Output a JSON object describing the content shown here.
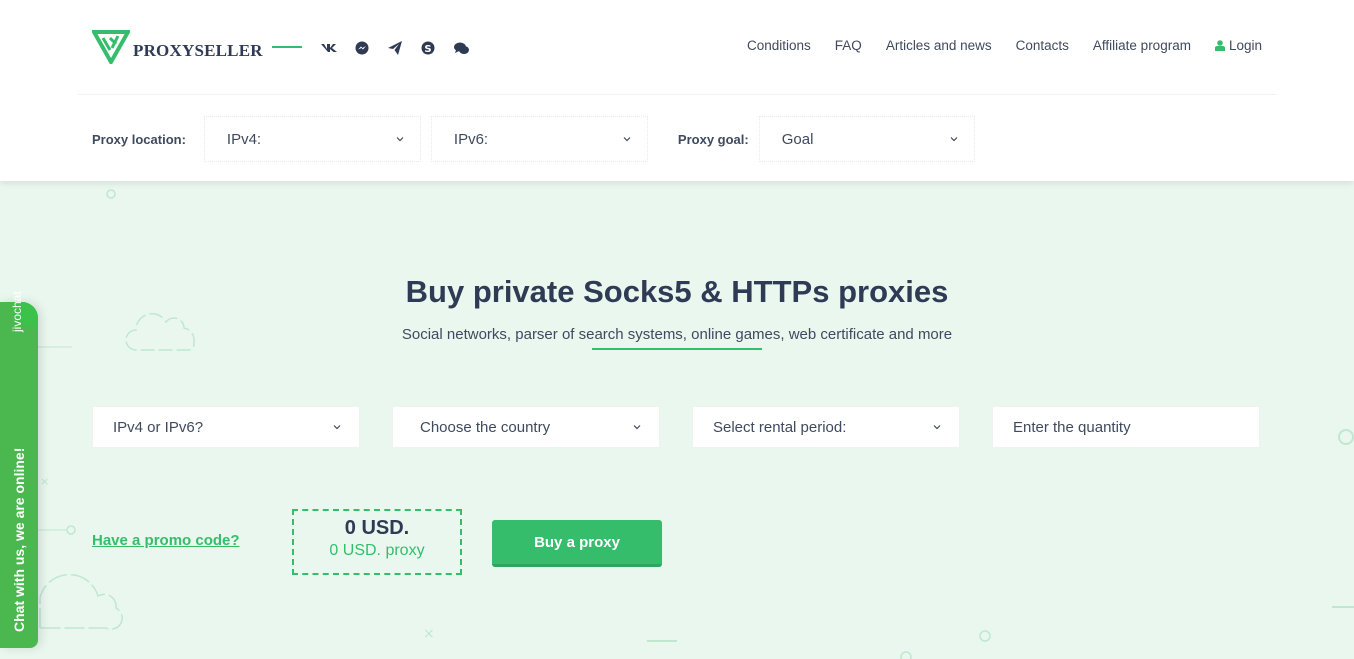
{
  "header": {
    "brand": "PROXYSELLER",
    "social_icons": [
      "vk-icon",
      "messenger-icon",
      "telegram-icon",
      "skype-icon",
      "chat-bubbles-icon"
    ],
    "nav": [
      {
        "label": "Conditions"
      },
      {
        "label": "FAQ"
      },
      {
        "label": "Articles and news"
      },
      {
        "label": "Contacts"
      },
      {
        "label": "Affiliate program"
      },
      {
        "label": "Login",
        "icon": "user-icon"
      }
    ]
  },
  "filters": {
    "location_label": "Proxy location:",
    "ipv4_value": "IPv4:",
    "ipv6_value": "IPv6:",
    "goal_label": "Proxy goal:",
    "goal_value": "Goal"
  },
  "hero": {
    "title": "Buy private Socks5 & HTTPs proxies",
    "subtitle": "Social networks, parser of search systems, online games, web certificate and more"
  },
  "order": {
    "protocol_value": "IPv4 or IPv6?",
    "country_value": "Choose the country",
    "period_value": "Select rental period:",
    "quantity_placeholder": "Enter the quantity",
    "promo_link": "Have a promo code?",
    "total_price": "0 USD.",
    "unit_price": "0 USD. proxy",
    "buy_label": "Buy a proxy"
  },
  "chat": {
    "brand": "jivochat",
    "text": "Chat with us, we are online!"
  },
  "colors": {
    "accent": "#36bd6c",
    "text": "#2f3b55",
    "background": "#e9f7ef",
    "chat": "#4bb74f"
  }
}
